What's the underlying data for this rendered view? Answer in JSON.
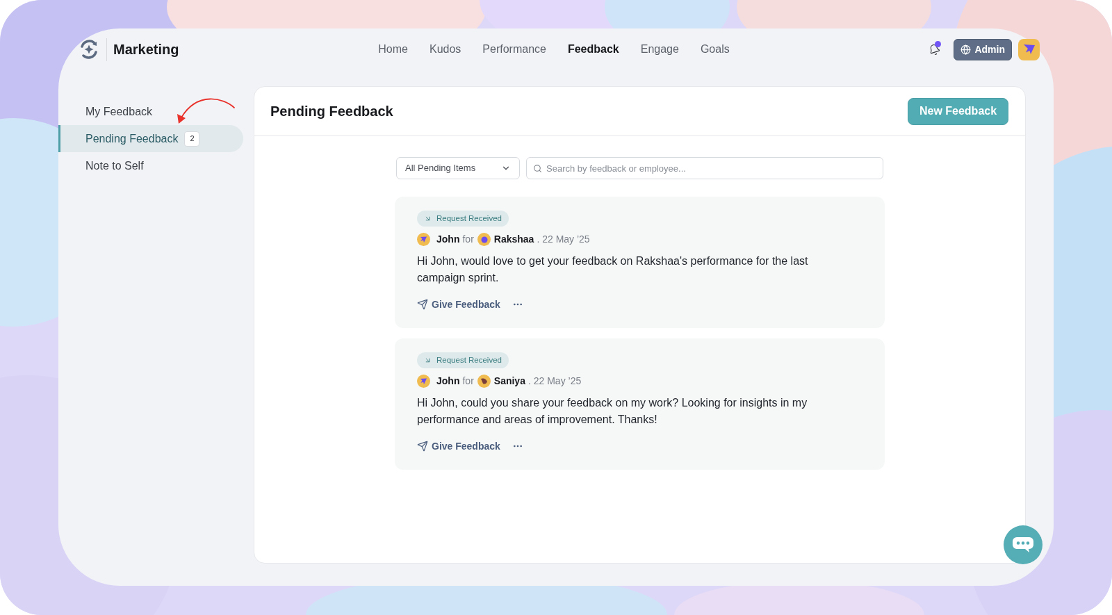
{
  "header": {
    "workspace": "Marketing",
    "nav": [
      {
        "label": "Home",
        "selected": false
      },
      {
        "label": "Kudos",
        "selected": false
      },
      {
        "label": "Performance",
        "selected": false
      },
      {
        "label": "Feedback",
        "selected": true
      },
      {
        "label": "Engage",
        "selected": false
      },
      {
        "label": "Goals",
        "selected": false
      }
    ],
    "notifications_unread": true,
    "role_button": "Admin"
  },
  "sidebar": {
    "items": [
      {
        "label": "My Feedback",
        "selected": false
      },
      {
        "label": "Pending Feedback",
        "selected": true,
        "count": "2"
      },
      {
        "label": "Note to Self",
        "selected": false
      }
    ]
  },
  "panel": {
    "title": "Pending Feedback",
    "new_button": "New Feedback",
    "filter": {
      "value": "All Pending Items"
    },
    "search": {
      "placeholder": "Search by feedback or employee..."
    },
    "items": [
      {
        "status": "Request Received",
        "author": "John",
        "connector": "for",
        "subject": "Rakshaa",
        "date": ". 22 May ’25",
        "message": "Hi John, would love to get your feedback on Rakshaa's performance for the last campaign sprint.",
        "action": "Give Feedback"
      },
      {
        "status": "Request Received",
        "author": "John",
        "connector": "for",
        "subject": "Saniya",
        "date": ". 22 May ’25",
        "message": "Hi John, could you share your feedback on my work? Looking for insights in my performance and areas of improvement. Thanks!",
        "action": "Give Feedback"
      }
    ]
  }
}
